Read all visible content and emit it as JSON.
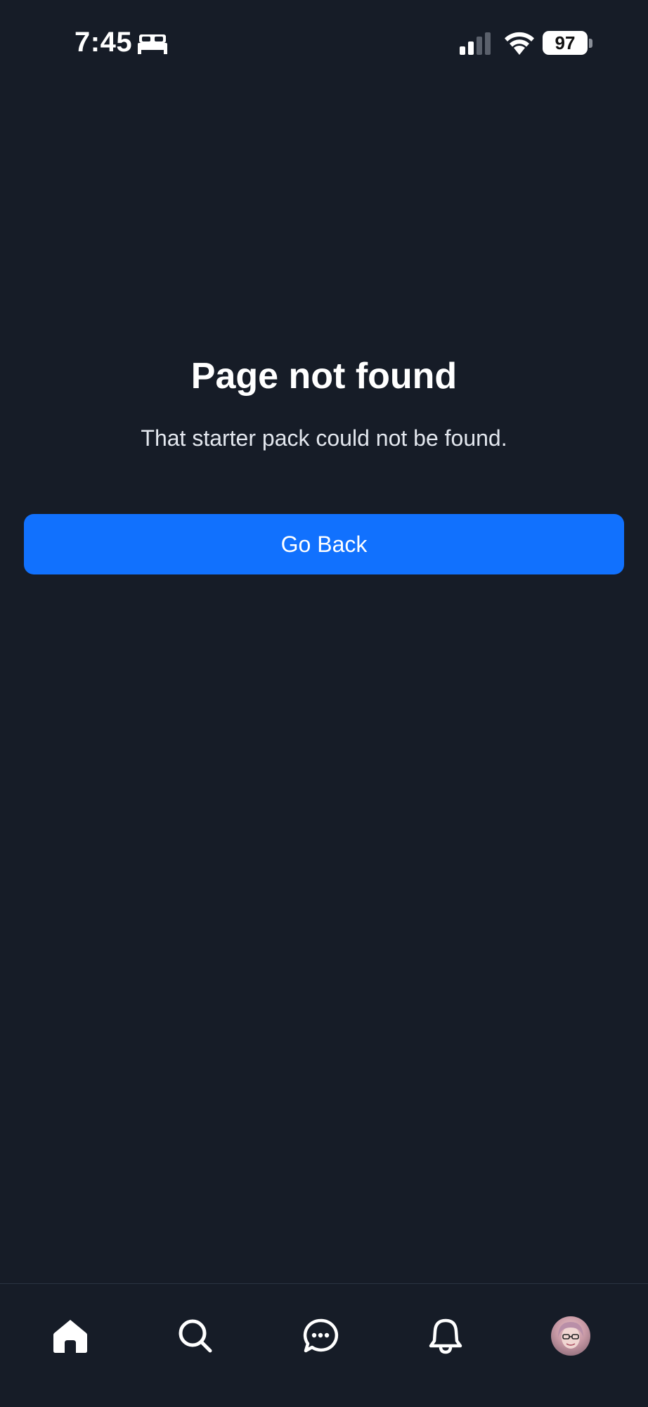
{
  "status_bar": {
    "time": "7:45",
    "battery_level": "97",
    "icons": [
      "bed-icon",
      "cellular-signal-icon",
      "wifi-icon",
      "battery-icon"
    ]
  },
  "main": {
    "title": "Page not found",
    "message": "That starter pack could not be found.",
    "go_back_label": "Go Back"
  },
  "bottom_nav": {
    "items": [
      {
        "icon": "home-icon",
        "active": true
      },
      {
        "icon": "search-icon",
        "active": false
      },
      {
        "icon": "chat-icon",
        "active": false
      },
      {
        "icon": "bell-icon",
        "active": false
      },
      {
        "icon": "avatar",
        "active": false
      }
    ]
  },
  "colors": {
    "background": "#161c27",
    "primary_button": "#1171fe",
    "text": "#ffffff"
  }
}
